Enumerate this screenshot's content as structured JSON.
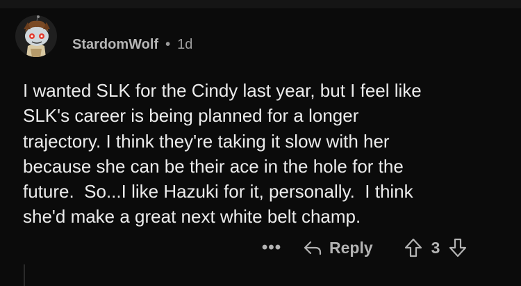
{
  "comment": {
    "author": "StardomWolf",
    "separator": "•",
    "age": "1d",
    "body": "I wanted SLK for the Cindy last year, but I feel like\nSLK's career is being planned for a longer\ntrajectory. I think they're taking it slow with her\nbecause she can be their ace in the hole for the\nfuture.  So...I like Hazuki for it, personally.  I think\nshe'd make a great next white belt champ.",
    "avatar_icon": "snoo-avatar-icon"
  },
  "actions": {
    "more_label": "•••",
    "reply_label": "Reply",
    "score": "3",
    "reply_icon": "reply-arrow-icon",
    "upvote_icon": "upvote-arrow-icon",
    "downvote_icon": "downvote-arrow-icon"
  },
  "colors": {
    "background": "#0b0b0b",
    "text": "#ececec",
    "muted": "#a9a9a9"
  }
}
